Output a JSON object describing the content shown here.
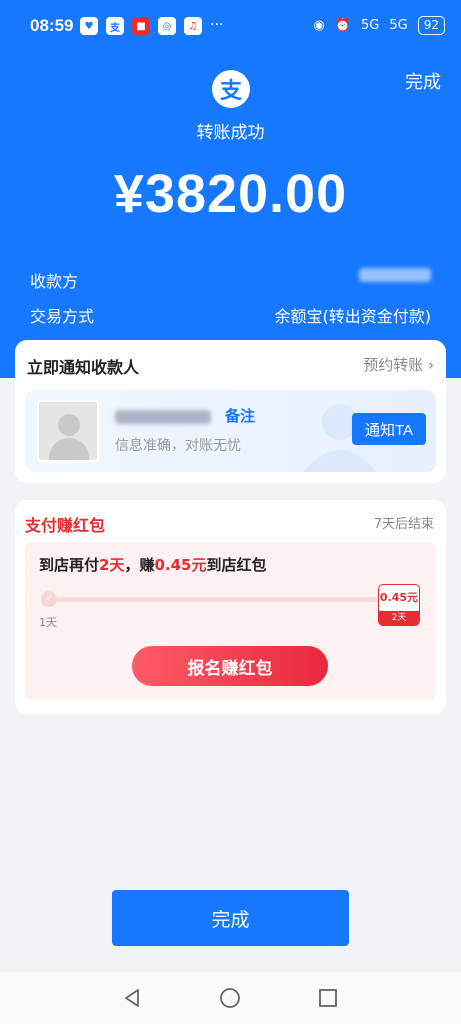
{
  "status_bar": {
    "time": "08:59",
    "battery": "92",
    "signal_1": "5G",
    "signal_2": "5G"
  },
  "header": {
    "done_label": "完成",
    "logo_char": "支",
    "status_text": "转账成功",
    "amount": "¥3820.00",
    "payee_label": "收款方",
    "method_label": "交易方式",
    "method_value": "余额宝(转出资金付款)"
  },
  "notify_card": {
    "title": "立即通知收款人",
    "schedule_link": "预约转账",
    "remark_label": "备注",
    "subtitle": "信息准确，对账无忧",
    "notify_button": "通知TA"
  },
  "promo_card": {
    "title": "支付赚红包",
    "ends_text": "7天后结束",
    "line_prefix": "到店再付",
    "line_days": "2天",
    "line_mid": "，赚",
    "line_amount": "0.45元",
    "line_suffix": "到店红包",
    "progress_start_label": "1天",
    "progress_fraction": 0,
    "badge_amount": "0.45元",
    "badge_days": "2天",
    "signup_button": "报名赚红包"
  },
  "footer": {
    "done_button": "完成"
  },
  "colors": {
    "brand_blue": "#1677ff",
    "promo_red": "#e62d32"
  }
}
